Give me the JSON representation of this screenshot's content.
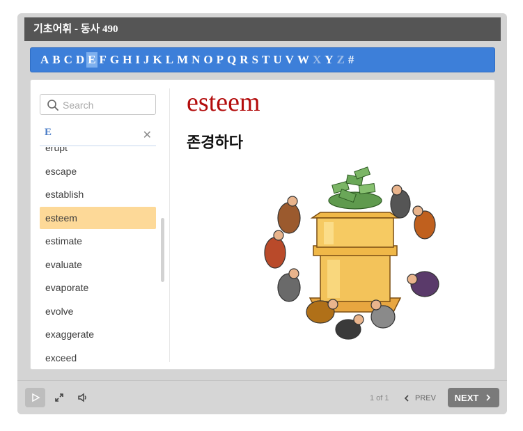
{
  "window": {
    "title": "기초어휘 - 동사 490"
  },
  "alphabet": {
    "letters": [
      "A",
      "B",
      "C",
      "D",
      "E",
      "F",
      "G",
      "H",
      "I",
      "J",
      "K",
      "L",
      "M",
      "N",
      "O",
      "P",
      "Q",
      "R",
      "S",
      "T",
      "U",
      "V",
      "W",
      "X",
      "Y",
      "Z",
      "#"
    ],
    "active": "E",
    "disabled": [
      "X",
      "Z"
    ]
  },
  "sidebar": {
    "search_placeholder": "Search",
    "filter_label": "E",
    "clear_icon": "close-icon",
    "items": [
      {
        "label": "erupt"
      },
      {
        "label": "escape"
      },
      {
        "label": "establish"
      },
      {
        "label": "esteem",
        "selected": true
      },
      {
        "label": "estimate"
      },
      {
        "label": "evaluate"
      },
      {
        "label": "evaporate"
      },
      {
        "label": "evolve"
      },
      {
        "label": "exaggerate"
      },
      {
        "label": "exceed"
      }
    ]
  },
  "entry": {
    "word": "esteem",
    "meaning": "존경하다",
    "word_color": "#b30c0c"
  },
  "footer": {
    "page_info": "1 of 1",
    "prev_label": "PREV",
    "next_label": "NEXT"
  },
  "colors": {
    "title_bar": "#555555",
    "letter_bar": "#3d7fd9",
    "selected_item": "#fdd998",
    "next_button": "#7a7a7a"
  }
}
